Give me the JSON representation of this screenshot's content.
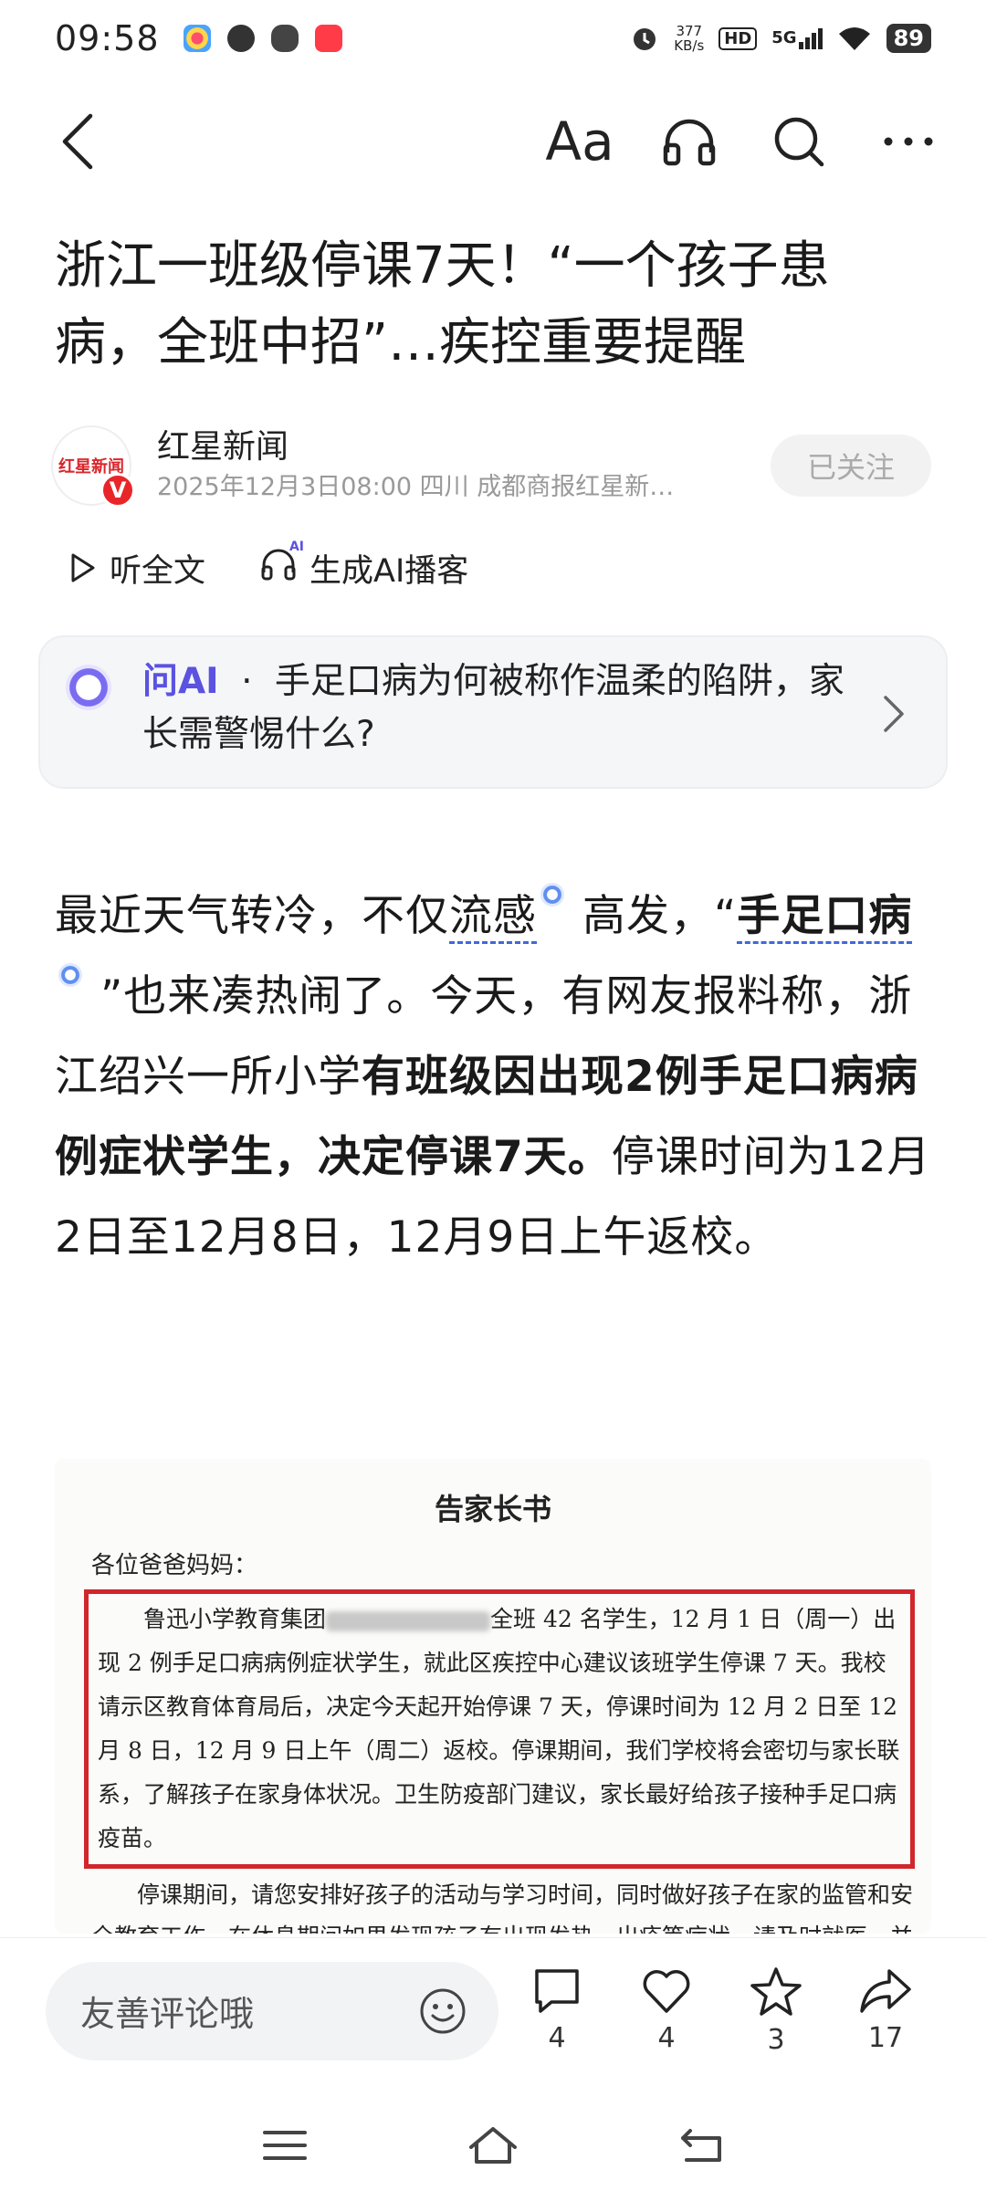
{
  "status_bar": {
    "time": "09:58",
    "net_speed_value": "377",
    "net_speed_unit": "KB/s",
    "hd": "HD",
    "network": "5G",
    "battery": "89"
  },
  "top_nav": {
    "font_size_label": "Aa"
  },
  "article": {
    "title": "浙江一班级停课7天！“一个孩子患病，全班中招”…疾控重要提醒",
    "author_name": "红星新闻",
    "avatar_text": "红星新闻",
    "verified_badge": "V",
    "author_meta": "2025年12月3日08:00 四川 成都商报红星新…",
    "follow_label": "已关注",
    "listen_label": "听全文",
    "ai_podcast_label": "生成AI播客",
    "ai_podcast_badge": "AI"
  },
  "ask_ai": {
    "label": "问AI",
    "separator": "·",
    "question": "手足口病为何被称作温柔的陷阱，家长需警惕什么?"
  },
  "body": {
    "part1": "最近天气转冷，不仅",
    "term1": "流感",
    "part2": " 高发，“",
    "term2": "手足口病",
    "part3": " ”也来凑热闹了。今天，有网友报料称，浙江绍兴一所小学",
    "bold": "有班级因出现2例手足口病病例症状学生，决定停课7天。",
    "part4": "停课时间为12月2日至12月8日，12月9日上午返校。"
  },
  "notice_image": {
    "title": "告家长书",
    "greeting": "各位爸爸妈妈：",
    "boxed_before_blur": "鲁迅小学教育集团",
    "boxed_after_blur": "全班 42 名学生，12 月 1 日（周一）出现 2 例手足口病病例症状学生，就此区疾控中心建议该班学生停课 7 天。我校请示区教育体育局后，决定今天起开始停课 7 天，停课时间为 12 月 2 日至 12 月 8 日，12 月 9 日上午（周二）返校。停课期间，我们学校将会密切与家长联系，了解孩子在家身体状况。卫生防疫部门建议，家长最好给孩子接种手足口病疫苗。",
    "para": "停课期间，请您安排好孩子的活动与学习时间，同时做好孩子在家的监管和安全教育工作。在休息期间如果发现孩子有出现发热、出疹等症状，请及时就医，并通知班主任老师。希望各位家长能让孩子在家静养，不要到人口密集的公共场"
  },
  "bottom_bar": {
    "comment_placeholder": "友善评论哦",
    "comments_count": "4",
    "likes_count": "4",
    "favorites_count": "3",
    "shares_count": "17"
  },
  "colors": {
    "accent_purple": "#5b52e0",
    "term_underline": "#3f68d8",
    "notice_box_red": "#d0262c",
    "verified_red": "#e8262a"
  }
}
